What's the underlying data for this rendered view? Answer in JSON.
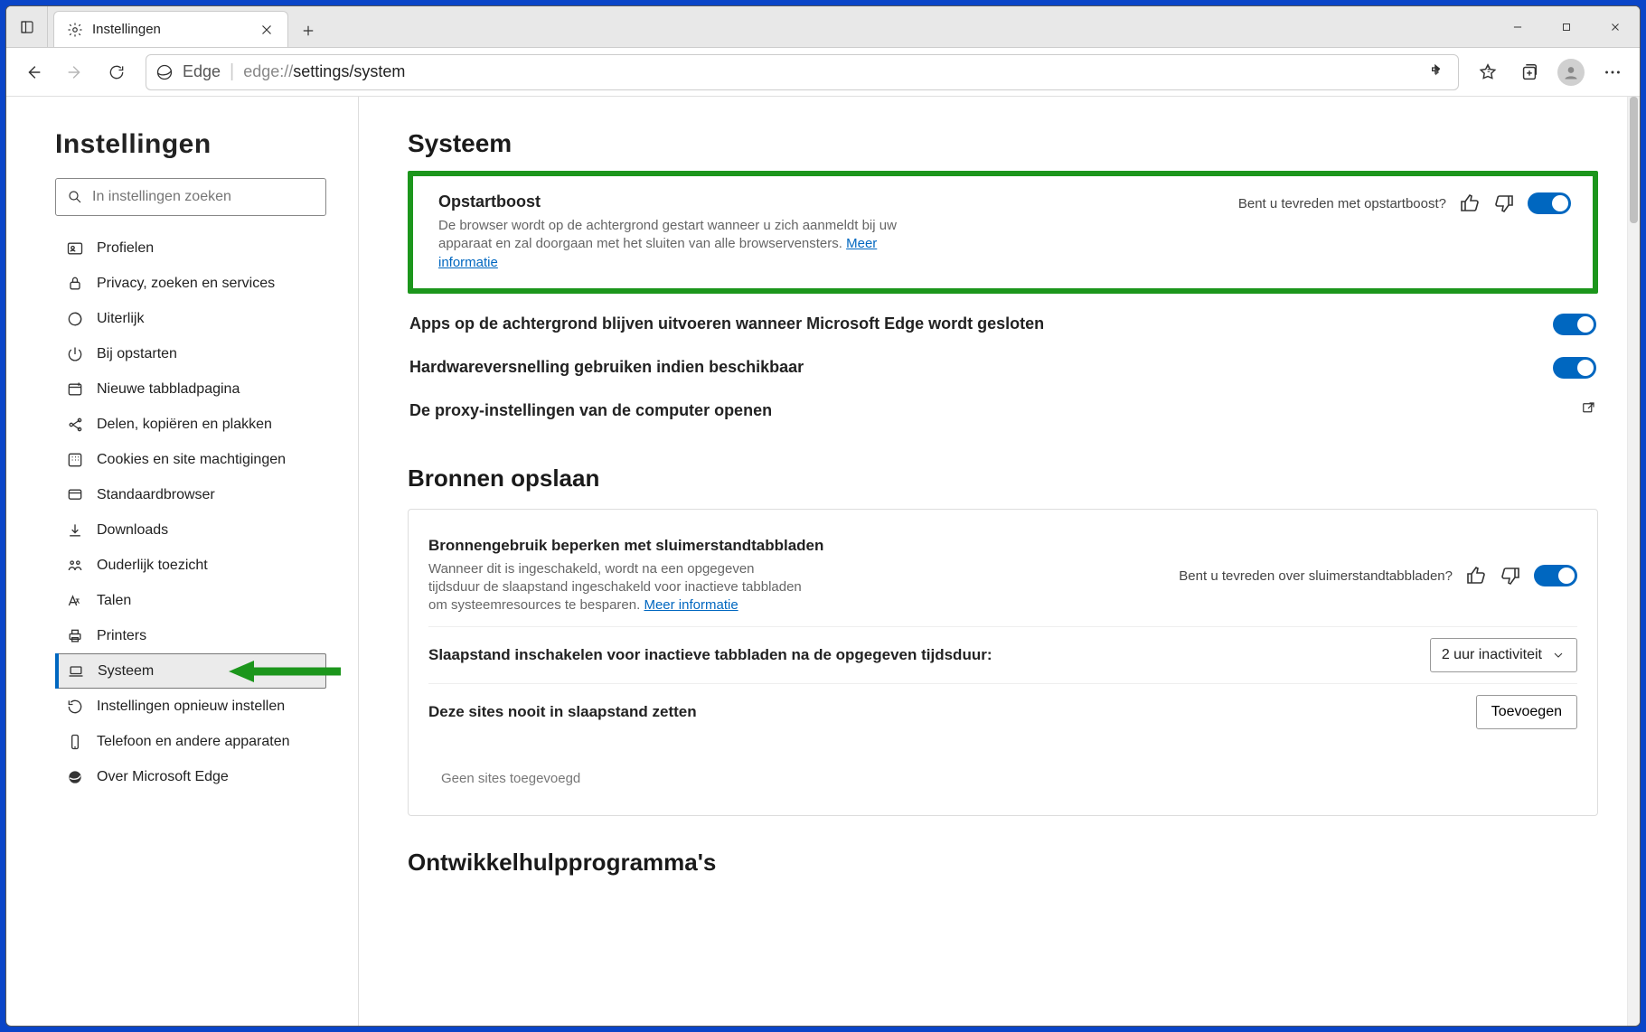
{
  "tab": {
    "title": "Instellingen"
  },
  "addressbar": {
    "edge_label": "Edge",
    "url_prefix": "edge://",
    "url_path": "settings/system"
  },
  "sidebar": {
    "heading": "Instellingen",
    "search_placeholder": "In instellingen zoeken",
    "items": [
      {
        "label": "Profielen"
      },
      {
        "label": "Privacy, zoeken en services"
      },
      {
        "label": "Uiterlijk"
      },
      {
        "label": "Bij opstarten"
      },
      {
        "label": "Nieuwe tabbladpagina"
      },
      {
        "label": "Delen, kopiëren en plakken"
      },
      {
        "label": "Cookies en site machtigingen"
      },
      {
        "label": "Standaardbrowser"
      },
      {
        "label": "Downloads"
      },
      {
        "label": "Ouderlijk toezicht"
      },
      {
        "label": "Talen"
      },
      {
        "label": "Printers"
      },
      {
        "label": "Systeem"
      },
      {
        "label": "Instellingen opnieuw instellen"
      },
      {
        "label": "Telefoon en andere apparaten"
      },
      {
        "label": "Over Microsoft Edge"
      }
    ]
  },
  "system": {
    "heading": "Systeem",
    "startup_boost": {
      "title": "Opstartboost",
      "desc": "De browser wordt op de achtergrond gestart wanneer u zich aanmeldt bij uw apparaat en zal doorgaan met het sluiten van alle browservensters.",
      "more_info": "Meer informatie",
      "feedback_q": "Bent u tevreden met opstartboost?"
    },
    "bg_apps": {
      "title": "Apps op de achtergrond blijven uitvoeren wanneer Microsoft Edge wordt gesloten"
    },
    "hw_accel": {
      "title": "Hardwareversnelling gebruiken indien beschikbaar"
    },
    "proxy": {
      "title": "De proxy-instellingen van de computer openen"
    }
  },
  "resources": {
    "heading": "Bronnen opslaan",
    "sleep_tabs": {
      "title": "Bronnengebruik beperken met sluimerstandtabbladen",
      "desc": "Wanneer dit is ingeschakeld, wordt na een opgegeven tijdsduur de slaapstand ingeschakeld voor inactieve tabbladen om systeemresources te besparen.",
      "more_info": "Meer informatie",
      "feedback_q": "Bent u tevreden over sluimerstandtabbladen?"
    },
    "sleep_after": {
      "title": "Slaapstand inschakelen voor inactieve tabbladen na de opgegeven tijdsduur:",
      "value": "2 uur inactiviteit"
    },
    "never_sleep": {
      "title": "Deze sites nooit in slaapstand zetten",
      "add_btn": "Toevoegen",
      "empty": "Geen sites toegevoegd"
    }
  },
  "dev": {
    "heading": "Ontwikkelhulpprogramma's"
  }
}
